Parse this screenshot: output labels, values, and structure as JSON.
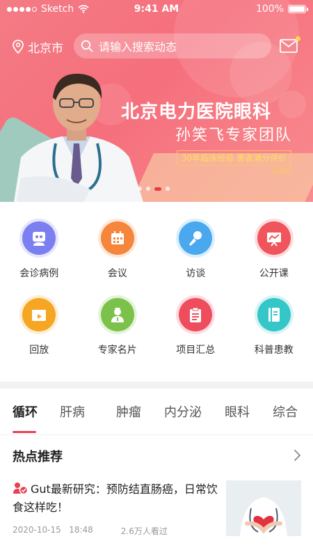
{
  "status_bar": {
    "carrier": "Sketch",
    "time": "9:41 AM",
    "battery": "100%"
  },
  "header": {
    "location": "北京市",
    "search_placeholder": "请输入搜索动态"
  },
  "banner": {
    "title": "北京电力医院眼科",
    "subtitle": "孙笑飞专家团队",
    "badge": "30年临床经验 患者满分评价",
    "page_count": 4,
    "active_page": 3
  },
  "grid": [
    {
      "label": "会诊病例",
      "icon": "consultation-icon",
      "color": "#7b7ff0"
    },
    {
      "label": "会议",
      "icon": "calendar-icon",
      "color": "#f5863b"
    },
    {
      "label": "访谈",
      "icon": "microphone-icon",
      "color": "#4aa8ee"
    },
    {
      "label": "公开课",
      "icon": "presentation-icon",
      "color": "#f0545c"
    },
    {
      "label": "回放",
      "icon": "play-icon",
      "color": "#f5a623"
    },
    {
      "label": "专家名片",
      "icon": "doctor-icon",
      "color": "#7cc24a"
    },
    {
      "label": "项目汇总",
      "icon": "clipboard-icon",
      "color": "#ee4d5e"
    },
    {
      "label": "科普患教",
      "icon": "book-icon",
      "color": "#35c6c8"
    }
  ],
  "tabs": [
    {
      "label": "循环",
      "active": true
    },
    {
      "label": "肝病",
      "active": false
    },
    {
      "label": "肿瘤",
      "active": false
    },
    {
      "label": "内分泌",
      "active": false
    },
    {
      "label": "眼科",
      "active": false
    },
    {
      "label": "综合",
      "active": false
    }
  ],
  "hot": {
    "title": "热点推荐",
    "news": {
      "title": "Gut最新研究：预防结直肠癌，日常饮食这样吃！",
      "date": "2020-10-15",
      "time": "18:48",
      "views": "2.6万人看过"
    }
  },
  "colors": {
    "accent": "#e8414f",
    "hero": "#f47b85"
  }
}
